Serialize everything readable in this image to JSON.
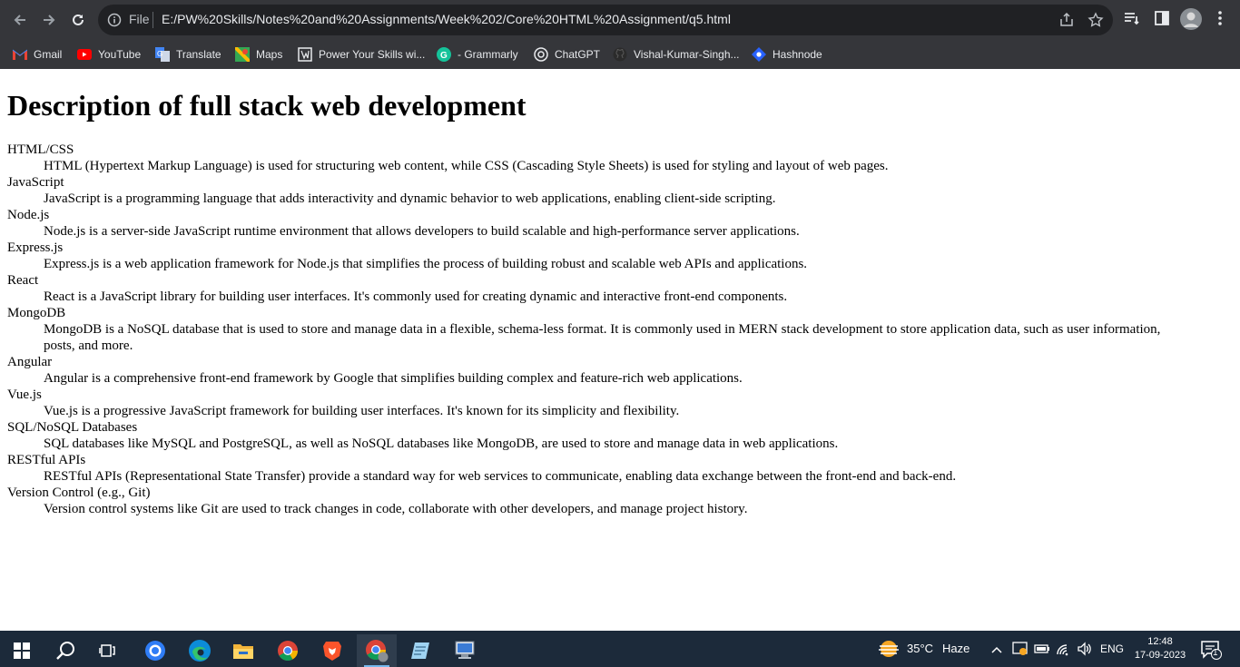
{
  "browser": {
    "omnibox_label": "File",
    "url": "E:/PW%20Skills/Notes%20and%20Assignments/Week%202/Core%20HTML%20Assignment/q5.html"
  },
  "bookmarks": [
    {
      "label": "Gmail",
      "icon": "gmail-icon"
    },
    {
      "label": "YouTube",
      "icon": "youtube-icon"
    },
    {
      "label": "Translate",
      "icon": "translate-icon"
    },
    {
      "label": "Maps",
      "icon": "maps-icon"
    },
    {
      "label": "Power Your Skills wi...",
      "icon": "pw-skills-icon"
    },
    {
      "label": "- Grammarly",
      "icon": "grammarly-icon"
    },
    {
      "label": "ChatGPT",
      "icon": "chatgpt-icon"
    },
    {
      "label": "Vishal-Kumar-Singh...",
      "icon": "github-icon"
    },
    {
      "label": "Hashnode",
      "icon": "hashnode-icon"
    }
  ],
  "page": {
    "title": "Description of full stack web development",
    "items": [
      {
        "term": "HTML/CSS",
        "desc": "HTML (Hypertext Markup Language) is used for structuring web content, while CSS (Cascading Style Sheets) is used for styling and layout of web pages."
      },
      {
        "term": "JavaScript",
        "desc": "JavaScript is a programming language that adds interactivity and dynamic behavior to web applications, enabling client-side scripting."
      },
      {
        "term": "Node.js",
        "desc": "Node.js is a server-side JavaScript runtime environment that allows developers to build scalable and high-performance server applications."
      },
      {
        "term": "Express.js",
        "desc": "Express.js is a web application framework for Node.js that simplifies the process of building robust and scalable web APIs and applications."
      },
      {
        "term": "React",
        "desc": "React is a JavaScript library for building user interfaces. It's commonly used for creating dynamic and interactive front-end components."
      },
      {
        "term": "MongoDB",
        "desc": "MongoDB is a NoSQL database that is used to store and manage data in a flexible, schema-less format. It is commonly used in MERN stack development to store application data, such as user information, posts, and more."
      },
      {
        "term": "Angular",
        "desc": "Angular is a comprehensive front-end framework by Google that simplifies building complex and feature-rich web applications."
      },
      {
        "term": "Vue.js",
        "desc": "Vue.js is a progressive JavaScript framework for building user interfaces. It's known for its simplicity and flexibility."
      },
      {
        "term": "SQL/NoSQL Databases",
        "desc": "SQL databases like MySQL and PostgreSQL, as well as NoSQL databases like MongoDB, are used to store and manage data in web applications."
      },
      {
        "term": "RESTful APIs",
        "desc": "RESTful APIs (Representational State Transfer) provide a standard way for web services to communicate, enabling data exchange between the front-end and back-end."
      },
      {
        "term": "Version Control (e.g., Git)",
        "desc": "Version control systems like Git are used to track changes in code, collaborate with other developers, and manage project history."
      }
    ]
  },
  "taskbar": {
    "weather_temp": "35°C",
    "weather_desc": "Haze",
    "language": "ENG",
    "time": "12:48",
    "date": "17-09-2023",
    "notification_count": "1",
    "apps": [
      "start-icon",
      "search-icon",
      "task-view-icon",
      "app-circle-icon",
      "edge-icon",
      "file-explorer-icon",
      "chrome-icon",
      "brave-icon",
      "chrome-profile-icon",
      "notepad-icon",
      "remote-desktop-icon"
    ]
  },
  "colors": {
    "toolbar_bg": "#35363a",
    "omnibox_bg": "#202124",
    "taskbar_bg": "#1c2a3a"
  }
}
